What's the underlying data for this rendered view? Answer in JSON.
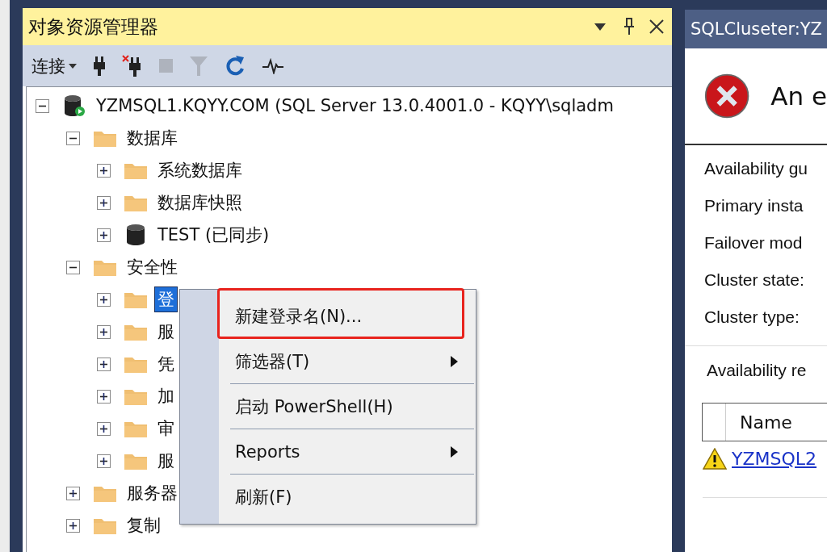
{
  "object_explorer": {
    "title": "对象资源管理器",
    "toolbar": {
      "connect_label": "连接",
      "tools": [
        {
          "kind": "connect",
          "disabled": false
        },
        {
          "kind": "disconnect",
          "disabled": false
        },
        {
          "kind": "stop",
          "disabled": true
        },
        {
          "kind": "filter",
          "disabled": true
        },
        {
          "kind": "refresh",
          "disabled": false
        },
        {
          "kind": "activity",
          "disabled": false
        }
      ]
    },
    "tree": [
      {
        "label": "YZMSQL1.KQYY.COM (SQL Server 13.0.4001.0 - KQYY\\sqladm",
        "kind": "server",
        "expanded": true,
        "selected": false,
        "children": [
          {
            "label": "数据库",
            "kind": "folder",
            "expanded": true,
            "selected": false,
            "children": [
              {
                "label": "系统数据库",
                "kind": "folder",
                "expanded": false,
                "selected": false
              },
              {
                "label": "数据库快照",
                "kind": "folder",
                "expanded": false,
                "selected": false
              },
              {
                "label": "TEST (已同步)",
                "kind": "database",
                "expanded": false,
                "selected": false
              }
            ]
          },
          {
            "label": "安全性",
            "kind": "folder",
            "expanded": true,
            "selected": false,
            "children": [
              {
                "label": "登",
                "kind": "folder",
                "expanded": false,
                "selected": true
              },
              {
                "label": "服",
                "kind": "folder",
                "expanded": false,
                "selected": false
              },
              {
                "label": "凭",
                "kind": "folder",
                "expanded": false,
                "selected": false
              },
              {
                "label": "加",
                "kind": "folder",
                "expanded": false,
                "selected": false
              },
              {
                "label": "审",
                "kind": "folder",
                "expanded": false,
                "selected": false
              },
              {
                "label": "服",
                "kind": "folder",
                "expanded": false,
                "selected": false
              }
            ]
          },
          {
            "label": "服务器",
            "kind": "folder",
            "expanded": false,
            "selected": false
          },
          {
            "label": "复制",
            "kind": "folder",
            "expanded": false,
            "selected": false
          }
        ]
      }
    ]
  },
  "context_menu": {
    "items": [
      {
        "label": "新建登录名(N)...",
        "separator_before": false,
        "submenu": false,
        "highlighted": true
      },
      {
        "label": "筛选器(T)",
        "separator_before": false,
        "submenu": true,
        "highlighted": false
      },
      {
        "label": "启动 PowerShell(H)",
        "separator_before": true,
        "submenu": false,
        "highlighted": false
      },
      {
        "label": "Reports",
        "separator_before": true,
        "submenu": true,
        "highlighted": false
      },
      {
        "label": "刷新(F)",
        "separator_before": true,
        "submenu": false,
        "highlighted": false
      }
    ]
  },
  "dashboard": {
    "title": "SQLCluseter:YZ",
    "heading": "An e",
    "fields": [
      "Availability gu",
      "Primary insta",
      "Failover mod",
      "Cluster state:",
      "Cluster type:"
    ],
    "section": "Availability re",
    "table": {
      "columns": [
        "Name"
      ],
      "rows": [
        {
          "name": "YZMSQL2",
          "warning": true
        }
      ]
    }
  }
}
